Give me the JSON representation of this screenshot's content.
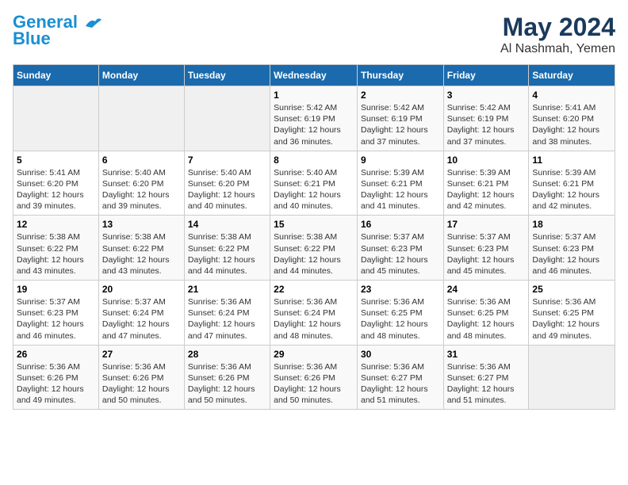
{
  "header": {
    "logo_line1": "General",
    "logo_line2": "Blue",
    "main_title": "May 2024",
    "sub_title": "Al Nashmah, Yemen"
  },
  "days_of_week": [
    "Sunday",
    "Monday",
    "Tuesday",
    "Wednesday",
    "Thursday",
    "Friday",
    "Saturday"
  ],
  "weeks": [
    [
      {
        "day": "",
        "info": ""
      },
      {
        "day": "",
        "info": ""
      },
      {
        "day": "",
        "info": ""
      },
      {
        "day": "1",
        "info": "Sunrise: 5:42 AM\nSunset: 6:19 PM\nDaylight: 12 hours\nand 36 minutes."
      },
      {
        "day": "2",
        "info": "Sunrise: 5:42 AM\nSunset: 6:19 PM\nDaylight: 12 hours\nand 37 minutes."
      },
      {
        "day": "3",
        "info": "Sunrise: 5:42 AM\nSunset: 6:19 PM\nDaylight: 12 hours\nand 37 minutes."
      },
      {
        "day": "4",
        "info": "Sunrise: 5:41 AM\nSunset: 6:20 PM\nDaylight: 12 hours\nand 38 minutes."
      }
    ],
    [
      {
        "day": "5",
        "info": "Sunrise: 5:41 AM\nSunset: 6:20 PM\nDaylight: 12 hours\nand 39 minutes."
      },
      {
        "day": "6",
        "info": "Sunrise: 5:40 AM\nSunset: 6:20 PM\nDaylight: 12 hours\nand 39 minutes."
      },
      {
        "day": "7",
        "info": "Sunrise: 5:40 AM\nSunset: 6:20 PM\nDaylight: 12 hours\nand 40 minutes."
      },
      {
        "day": "8",
        "info": "Sunrise: 5:40 AM\nSunset: 6:21 PM\nDaylight: 12 hours\nand 40 minutes."
      },
      {
        "day": "9",
        "info": "Sunrise: 5:39 AM\nSunset: 6:21 PM\nDaylight: 12 hours\nand 41 minutes."
      },
      {
        "day": "10",
        "info": "Sunrise: 5:39 AM\nSunset: 6:21 PM\nDaylight: 12 hours\nand 42 minutes."
      },
      {
        "day": "11",
        "info": "Sunrise: 5:39 AM\nSunset: 6:21 PM\nDaylight: 12 hours\nand 42 minutes."
      }
    ],
    [
      {
        "day": "12",
        "info": "Sunrise: 5:38 AM\nSunset: 6:22 PM\nDaylight: 12 hours\nand 43 minutes."
      },
      {
        "day": "13",
        "info": "Sunrise: 5:38 AM\nSunset: 6:22 PM\nDaylight: 12 hours\nand 43 minutes."
      },
      {
        "day": "14",
        "info": "Sunrise: 5:38 AM\nSunset: 6:22 PM\nDaylight: 12 hours\nand 44 minutes."
      },
      {
        "day": "15",
        "info": "Sunrise: 5:38 AM\nSunset: 6:22 PM\nDaylight: 12 hours\nand 44 minutes."
      },
      {
        "day": "16",
        "info": "Sunrise: 5:37 AM\nSunset: 6:23 PM\nDaylight: 12 hours\nand 45 minutes."
      },
      {
        "day": "17",
        "info": "Sunrise: 5:37 AM\nSunset: 6:23 PM\nDaylight: 12 hours\nand 45 minutes."
      },
      {
        "day": "18",
        "info": "Sunrise: 5:37 AM\nSunset: 6:23 PM\nDaylight: 12 hours\nand 46 minutes."
      }
    ],
    [
      {
        "day": "19",
        "info": "Sunrise: 5:37 AM\nSunset: 6:23 PM\nDaylight: 12 hours\nand 46 minutes."
      },
      {
        "day": "20",
        "info": "Sunrise: 5:37 AM\nSunset: 6:24 PM\nDaylight: 12 hours\nand 47 minutes."
      },
      {
        "day": "21",
        "info": "Sunrise: 5:36 AM\nSunset: 6:24 PM\nDaylight: 12 hours\nand 47 minutes."
      },
      {
        "day": "22",
        "info": "Sunrise: 5:36 AM\nSunset: 6:24 PM\nDaylight: 12 hours\nand 48 minutes."
      },
      {
        "day": "23",
        "info": "Sunrise: 5:36 AM\nSunset: 6:25 PM\nDaylight: 12 hours\nand 48 minutes."
      },
      {
        "day": "24",
        "info": "Sunrise: 5:36 AM\nSunset: 6:25 PM\nDaylight: 12 hours\nand 48 minutes."
      },
      {
        "day": "25",
        "info": "Sunrise: 5:36 AM\nSunset: 6:25 PM\nDaylight: 12 hours\nand 49 minutes."
      }
    ],
    [
      {
        "day": "26",
        "info": "Sunrise: 5:36 AM\nSunset: 6:26 PM\nDaylight: 12 hours\nand 49 minutes."
      },
      {
        "day": "27",
        "info": "Sunrise: 5:36 AM\nSunset: 6:26 PM\nDaylight: 12 hours\nand 50 minutes."
      },
      {
        "day": "28",
        "info": "Sunrise: 5:36 AM\nSunset: 6:26 PM\nDaylight: 12 hours\nand 50 minutes."
      },
      {
        "day": "29",
        "info": "Sunrise: 5:36 AM\nSunset: 6:26 PM\nDaylight: 12 hours\nand 50 minutes."
      },
      {
        "day": "30",
        "info": "Sunrise: 5:36 AM\nSunset: 6:27 PM\nDaylight: 12 hours\nand 51 minutes."
      },
      {
        "day": "31",
        "info": "Sunrise: 5:36 AM\nSunset: 6:27 PM\nDaylight: 12 hours\nand 51 minutes."
      },
      {
        "day": "",
        "info": ""
      }
    ]
  ]
}
